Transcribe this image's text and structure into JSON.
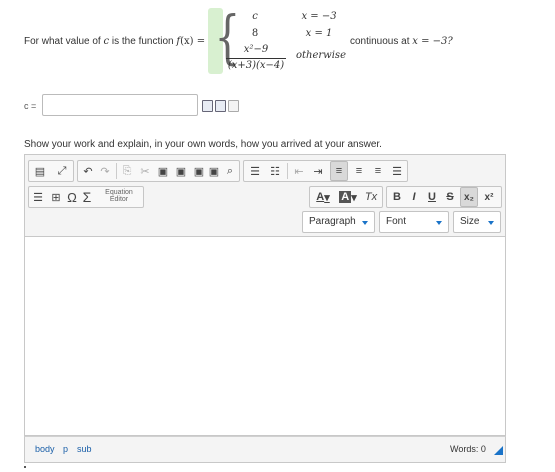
{
  "question": {
    "prefix_pre": "For what value of",
    "var_c": "c",
    "prefix_mid": "is the function",
    "func": "f",
    "func_arg": "(x) =",
    "cases": [
      {
        "value": "c",
        "condition": "x = −3"
      },
      {
        "value": "8",
        "condition": "x = 1"
      },
      {
        "value_num": "x²−9",
        "value_den": "(x+3)(x−4)",
        "condition": "otherwise"
      }
    ],
    "suffix": "continuous at",
    "suffix_math": "x = −3?"
  },
  "answer": {
    "label": "c =",
    "value": "",
    "placeholder": ""
  },
  "work_prompt": "Show your work and explain, in your own words, how you arrived at your answer.",
  "editor": {
    "equation_editor_line1": "Equation",
    "equation_editor_line2": "Editor",
    "paragraph_select": "Paragraph",
    "font_select": "Font",
    "size_select": "Size",
    "bold": "B",
    "italic": "I",
    "underline": "U",
    "strike": "S",
    "subscript": "x₂",
    "superscript": "x²",
    "omega": "Ω",
    "sigma": "Σ",
    "font_color": "A",
    "bg_color": "A",
    "clear_format": "Tx",
    "status_path": [
      "body",
      "p",
      "sub"
    ],
    "word_count": "Words: 0"
  },
  "colors": {
    "accent": "#1a73c8",
    "brace_highlight": "#d8f0d0"
  }
}
